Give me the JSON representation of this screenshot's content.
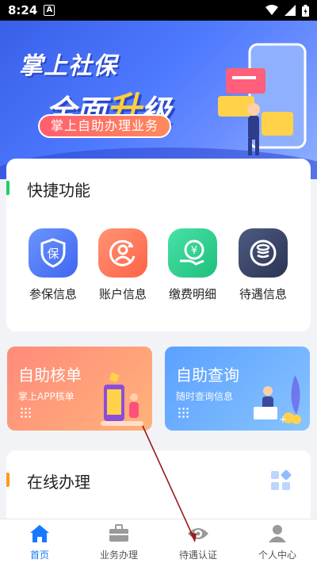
{
  "status": {
    "time": "8:24",
    "notification": "A"
  },
  "banner": {
    "line1": "掌上社保",
    "line2_prefix": "全面",
    "line2_highlight": "升",
    "line2_suffix": "级",
    "pill": "掌上自助办理业务"
  },
  "quick": {
    "title": "快捷功能",
    "items": [
      {
        "label": "参保信息",
        "icon": "shield-bao-icon",
        "color": "#4f7bff",
        "glyph": "保"
      },
      {
        "label": "账户信息",
        "icon": "user-refresh-icon",
        "color": "#ff7a5c",
        "glyph": ""
      },
      {
        "label": "缴费明细",
        "icon": "yen-hand-icon",
        "color": "#2ecf8e",
        "glyph": "¥"
      },
      {
        "label": "待遇信息",
        "icon": "coin-stack-icon",
        "color": "#3c4a6e",
        "glyph": ""
      }
    ]
  },
  "features": [
    {
      "title": "自助核单",
      "subtitle": "掌上APP核单"
    },
    {
      "title": "自助查询",
      "subtitle": "随时查询信息"
    }
  ],
  "online": {
    "title": "在线办理"
  },
  "nav": {
    "active": "home",
    "items": [
      {
        "key": "home",
        "label": "首页",
        "icon": "home-icon"
      },
      {
        "key": "business",
        "label": "业务办理",
        "icon": "briefcase-icon"
      },
      {
        "key": "certify",
        "label": "待遇认证",
        "icon": "eye-icon"
      },
      {
        "key": "profile",
        "label": "个人中心",
        "icon": "person-icon"
      }
    ]
  }
}
